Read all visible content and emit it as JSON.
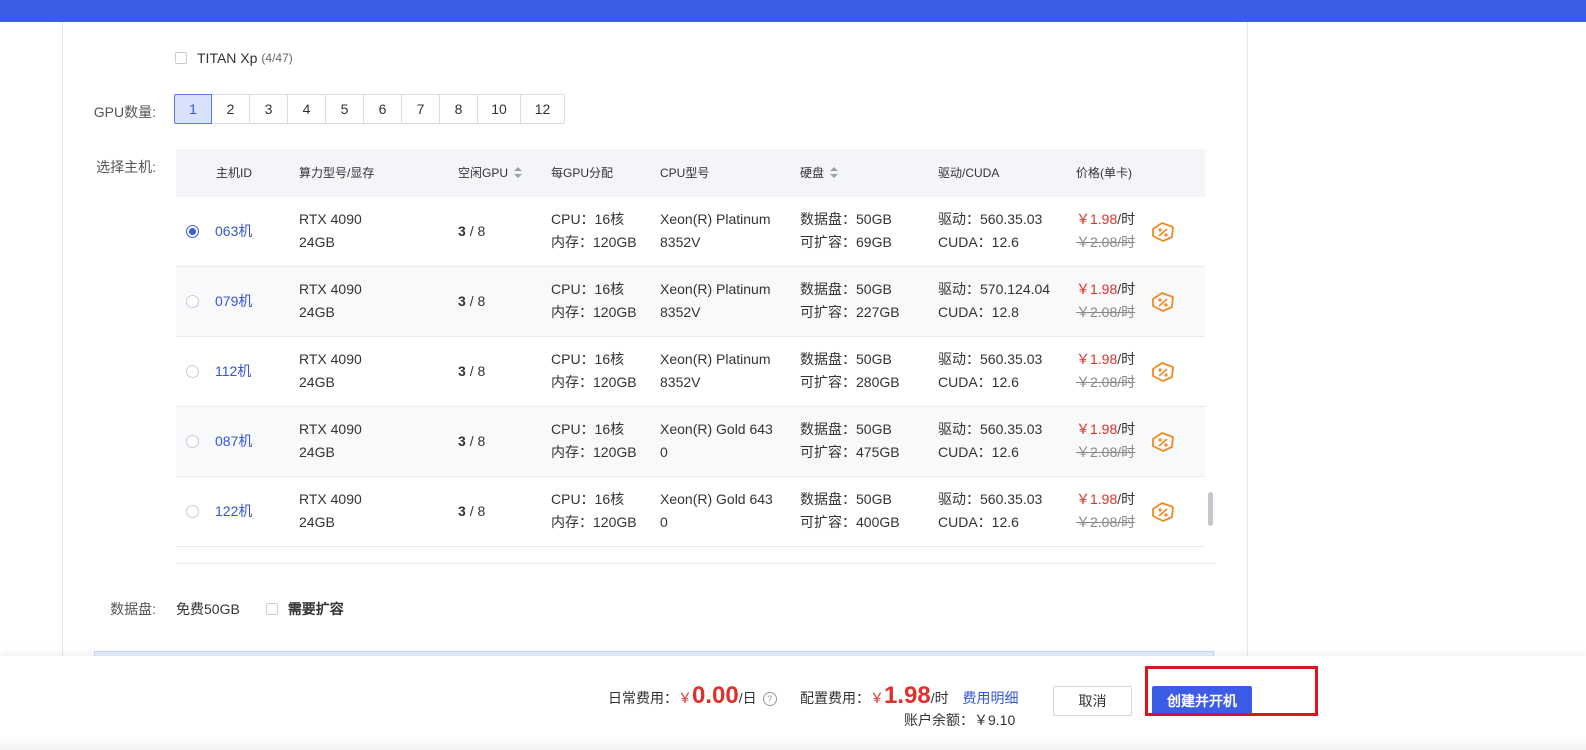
{
  "gpu_model_option": {
    "name": "TITAN Xp",
    "count": "(4/47)"
  },
  "labels": {
    "gpu_count": "GPU数量:",
    "select_host": "选择主机:",
    "data_disk": "数据盘:"
  },
  "gpu_count_options": [
    "1",
    "2",
    "3",
    "4",
    "5",
    "6",
    "7",
    "8",
    "10",
    "12"
  ],
  "gpu_count_selected": "1",
  "table": {
    "headers": [
      "主机ID",
      "算力型号/显存",
      "空闲GPU",
      "每GPU分配",
      "CPU型号",
      "硬盘",
      "驱动/CUDA",
      "价格(单卡)"
    ],
    "rows": [
      {
        "id": "063机",
        "gpu": "RTX 4090",
        "vram": "24GB",
        "free": "3",
        "total": "/ 8",
        "cpu_alloc": "CPU：16核",
        "mem": "内存：120GB",
        "cpu_model_1": "Xeon(R) Platinum",
        "cpu_model_2": "8352V",
        "disk": "数据盘：50GB",
        "expand": "可扩容：69GB",
        "driver": "驱动：560.35.03",
        "cuda": "CUDA：12.6",
        "price_now": "￥1.98",
        "unit": "/时",
        "price_old": "￥2.08/时",
        "selected": true
      },
      {
        "id": "079机",
        "gpu": "RTX 4090",
        "vram": "24GB",
        "free": "3",
        "total": "/ 8",
        "cpu_alloc": "CPU：16核",
        "mem": "内存：120GB",
        "cpu_model_1": "Xeon(R) Platinum",
        "cpu_model_2": "8352V",
        "disk": "数据盘：50GB",
        "expand": "可扩容：227GB",
        "driver": "驱动：570.124.04",
        "cuda": "CUDA：12.8",
        "price_now": "￥1.98",
        "unit": "/时",
        "price_old": "￥2.08/时",
        "selected": false
      },
      {
        "id": "112机",
        "gpu": "RTX 4090",
        "vram": "24GB",
        "free": "3",
        "total": "/ 8",
        "cpu_alloc": "CPU：16核",
        "mem": "内存：120GB",
        "cpu_model_1": "Xeon(R) Platinum",
        "cpu_model_2": "8352V",
        "disk": "数据盘：50GB",
        "expand": "可扩容：280GB",
        "driver": "驱动：560.35.03",
        "cuda": "CUDA：12.6",
        "price_now": "￥1.98",
        "unit": "/时",
        "price_old": "￥2.08/时",
        "selected": false
      },
      {
        "id": "087机",
        "gpu": "RTX 4090",
        "vram": "24GB",
        "free": "3",
        "total": "/ 8",
        "cpu_alloc": "CPU：16核",
        "mem": "内存：120GB",
        "cpu_model_1": "Xeon(R) Gold 643",
        "cpu_model_2": "0",
        "disk": "数据盘：50GB",
        "expand": "可扩容：475GB",
        "driver": "驱动：560.35.03",
        "cuda": "CUDA：12.6",
        "price_now": "￥1.98",
        "unit": "/时",
        "price_old": "￥2.08/时",
        "selected": false
      },
      {
        "id": "122机",
        "gpu": "RTX 4090",
        "vram": "24GB",
        "free": "3",
        "total": "/ 8",
        "cpu_alloc": "CPU：16核",
        "mem": "内存：120GB",
        "cpu_model_1": "Xeon(R) Gold 643",
        "cpu_model_2": "0",
        "disk": "数据盘：50GB",
        "expand": "可扩容：400GB",
        "driver": "驱动：560.35.03",
        "cuda": "CUDA：12.6",
        "price_now": "￥1.98",
        "unit": "/时",
        "price_old": "￥2.08/时",
        "selected": false
      }
    ]
  },
  "data_disk": {
    "free": "免费50GB",
    "expand_label": "需要扩容"
  },
  "footer": {
    "daily_label": "日常费用：",
    "currency": "￥",
    "daily_value": "0.00",
    "daily_unit": "/日",
    "config_label": "配置费用：",
    "config_value": "1.98",
    "config_unit": "/时",
    "detail_link": "费用明细",
    "balance_label": "账户余额：",
    "balance_value": "￥9.10",
    "cancel": "取消",
    "create": "创建并开机"
  },
  "colors": {
    "accent": "#3c5be6",
    "price_red": "#e0302c",
    "highlight": "#e0131b",
    "coupon": "#f08a24"
  }
}
